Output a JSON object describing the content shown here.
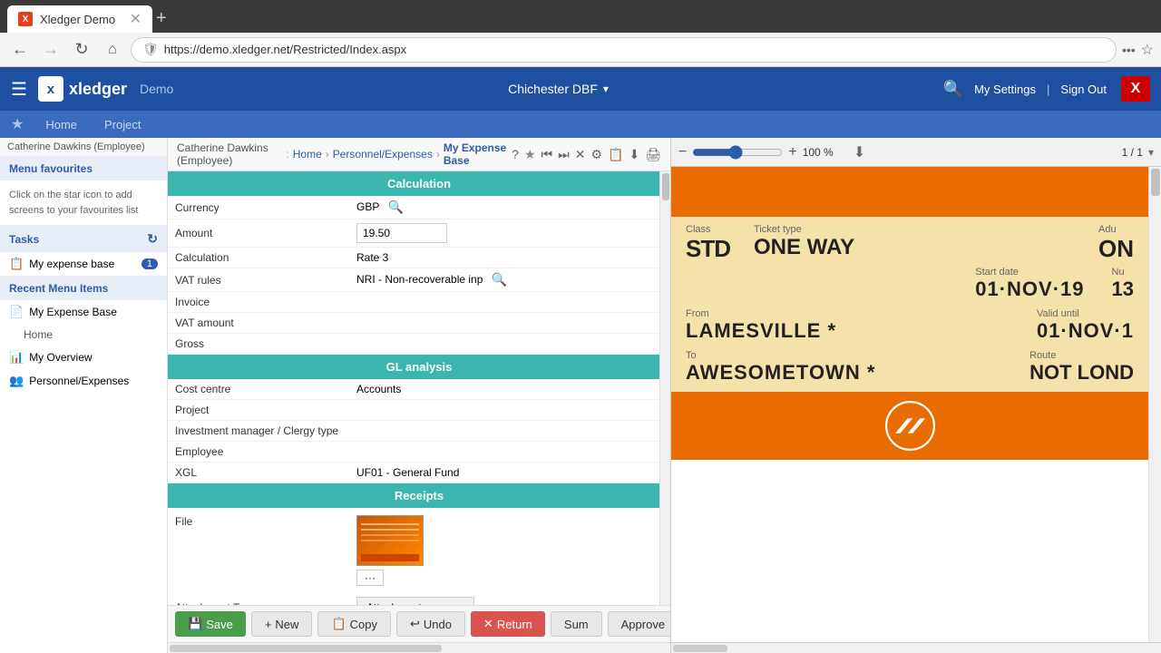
{
  "browser": {
    "tab_title": "Xledger Demo",
    "tab_icon": "X",
    "url": "https://demo.xledger.net/Restricted/Index.aspx"
  },
  "app": {
    "logo": "xledger",
    "demo_label": "Demo",
    "org": "Chichester DBF",
    "settings_label": "My Settings",
    "signout_label": "Sign Out"
  },
  "nav": {
    "tabs": [
      {
        "label": "Home",
        "active": false
      },
      {
        "label": "Project",
        "active": false
      }
    ]
  },
  "sidebar": {
    "employee_label": "Catherine Dawkins (Employee)",
    "menu_favourites": "Menu favourites",
    "favourites_info": "Click on the star icon to add screens to your favourites list",
    "tasks_label": "Tasks",
    "recent_label": "Recent Menu Items",
    "tasks_items": [
      {
        "label": "My expense base",
        "badge": "1"
      }
    ],
    "recent_items": [
      {
        "label": "My Expense Base",
        "icon": "doc"
      },
      {
        "label": "Home",
        "icon": "home"
      },
      {
        "label": "My Overview",
        "icon": "chart"
      },
      {
        "label": "Personnel/Expenses",
        "icon": "people"
      }
    ]
  },
  "breadcrumb": {
    "parts": [
      "Home",
      "Personnel/Expenses",
      "My Expense Base"
    ]
  },
  "form": {
    "calculation_header": "Calculation",
    "gl_header": "GL analysis",
    "receipts_header": "Receipts",
    "fields": {
      "currency_label": "Currency",
      "currency_value": "GBP",
      "amount_label": "Amount",
      "amount_value": "19.50",
      "calculation_label": "Calculation",
      "calculation_value": "Rate 3",
      "vat_rules_label": "VAT rules",
      "vat_rules_value": "NRI - Non-recoverable inp",
      "invoice_label": "Invoice",
      "vat_amount_label": "VAT amount",
      "gross_label": "Gross",
      "cost_centre_label": "Cost centre",
      "cost_centre_value": "Accounts",
      "project_label": "Project",
      "investment_manager_label": "Investment manager / Clergy type",
      "employee_label": "Employee",
      "xgl_label": "XGL",
      "xgl_value": "UF01 - General Fund",
      "file_label": "File",
      "attachment_type_label": "Attachment Type",
      "attachment_type_value": "Attachment"
    }
  },
  "toolbar": {
    "save_label": "Save",
    "new_label": "New",
    "copy_label": "Copy",
    "undo_label": "Undo",
    "return_label": "Return",
    "sum_label": "Sum",
    "approve_label": "Approve"
  },
  "preview": {
    "zoom_percent": "100 %",
    "page_info": "1 / 1",
    "ticket": {
      "class_label": "Class",
      "class_value": "STD",
      "ticket_type_label": "Ticket type",
      "ticket_type_value": "ONE WAY",
      "adult_label": "Adu",
      "adult_value": "ON",
      "start_date_label": "Start date",
      "start_date_value": "01·NOV·19",
      "num_label": "Nu",
      "num_value": "13",
      "from_label": "From",
      "from_value": "LAMESVILLE *",
      "valid_until_label": "Valid until",
      "valid_until_value": "01·NOV·1",
      "to_label": "To",
      "to_value": "AWESOMETOWN *",
      "route_label": "Route",
      "route_value": "NOT LOND"
    }
  }
}
